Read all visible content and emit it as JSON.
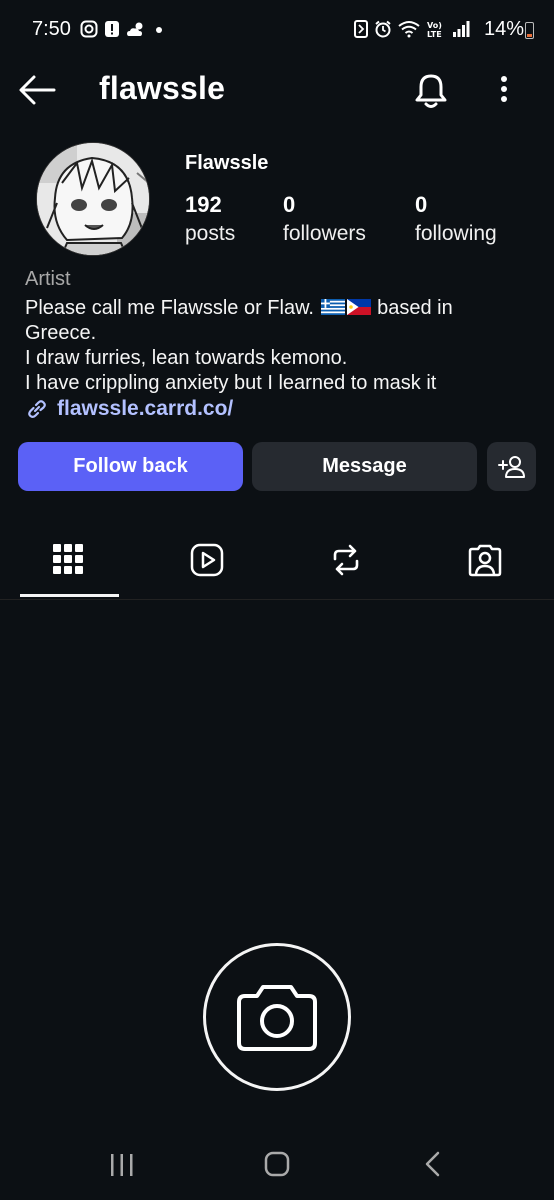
{
  "status_bar": {
    "time": "7:50",
    "battery": "14%",
    "left_icons": [
      "instagram-icon",
      "alert-icon",
      "weather-icon",
      "dot-icon"
    ],
    "right_icons": [
      "nfc-icon",
      "alarm-icon",
      "wifi-icon",
      "volte-icon",
      "signal-icon"
    ]
  },
  "header": {
    "username": "flawssle"
  },
  "profile": {
    "name": "Flawssle",
    "stats": [
      {
        "num": "192",
        "label": "posts"
      },
      {
        "num": "0",
        "label": "followers"
      },
      {
        "num": "0",
        "label": "following"
      }
    ],
    "category": "Artist",
    "bio_line1_pre": "Please call me Flawssle or Flaw. ",
    "bio_line1_post": " based in",
    "bio_line2": "Greece.",
    "bio_line3": "I draw furries, lean towards kemono.",
    "bio_line4": "I have crippling anxiety but I learned to mask it",
    "link": "flawssle.carrd.co/"
  },
  "actions": {
    "follow_label": "Follow back",
    "message_label": "Message"
  },
  "tabs": [
    "grid-icon",
    "reels-icon",
    "reposts-icon",
    "tagged-icon"
  ],
  "colors": {
    "background": "#0c1014",
    "primary_button": "#5b61f6",
    "secondary_button": "#262a30",
    "link": "#b3c1ff"
  }
}
